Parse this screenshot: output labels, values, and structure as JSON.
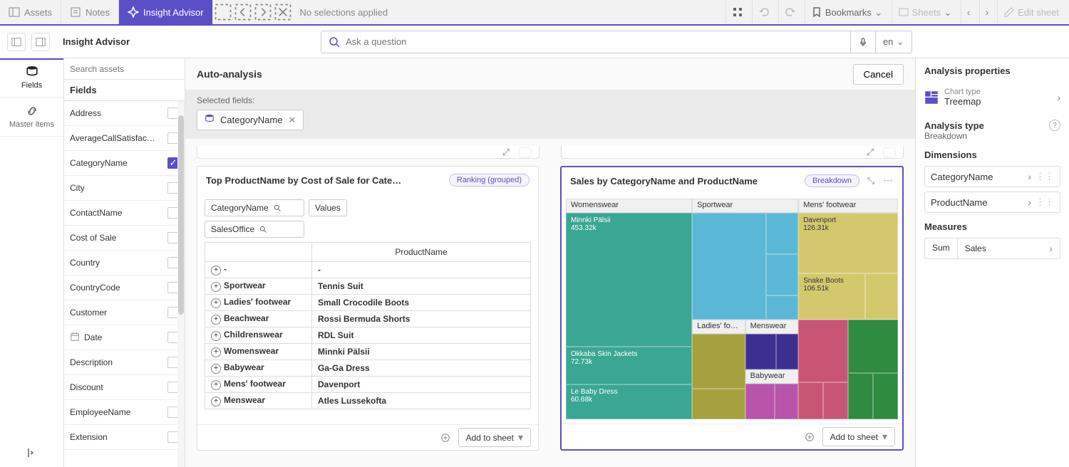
{
  "topbar": {
    "assets": "Assets",
    "notes": "Notes",
    "insight_advisor": "Insight Advisor",
    "no_selections": "No selections applied",
    "bookmarks": "Bookmarks",
    "sheets": "Sheets",
    "edit_sheet": "Edit sheet"
  },
  "row2": {
    "title": "Insight Advisor",
    "placeholder": "Ask a question",
    "lang": "en"
  },
  "rail": {
    "fields": "Fields",
    "master": "Master items"
  },
  "fields": {
    "search_placeholder": "Search assets",
    "header": "Fields",
    "items": [
      {
        "name": "Address",
        "checked": false
      },
      {
        "name": "AverageCallSatisfac…",
        "checked": false
      },
      {
        "name": "CategoryName",
        "checked": true
      },
      {
        "name": "City",
        "checked": false
      },
      {
        "name": "ContactName",
        "checked": false
      },
      {
        "name": "Cost of Sale",
        "checked": false
      },
      {
        "name": "Country",
        "checked": false
      },
      {
        "name": "CountryCode",
        "checked": false
      },
      {
        "name": "Customer",
        "checked": false
      },
      {
        "name": "Date",
        "checked": false,
        "date": true
      },
      {
        "name": "Description",
        "checked": false
      },
      {
        "name": "Discount",
        "checked": false
      },
      {
        "name": "EmployeeName",
        "checked": false
      },
      {
        "name": "Extension",
        "checked": false
      }
    ]
  },
  "center": {
    "title": "Auto-analysis",
    "cancel": "Cancel",
    "selected_label": "Selected fields:",
    "chip": "CategoryName",
    "card1": {
      "title": "Top ProductName by Cost of Sale for Cate…",
      "tag": "Ranking (grouped)",
      "pills": {
        "catname": "CategoryName",
        "salesoffice": "SalesOffice",
        "values": "Values"
      },
      "colhdr": "ProductName",
      "rows": [
        {
          "c": "-",
          "p": "-"
        },
        {
          "c": "Sportwear",
          "p": "Tennis Suit"
        },
        {
          "c": "Ladies' footwear",
          "p": "Small Crocodile Boots"
        },
        {
          "c": "Beachwear",
          "p": "Rossi Bermuda Shorts"
        },
        {
          "c": "Childrenswear",
          "p": "RDL Suit"
        },
        {
          "c": "Womenswear",
          "p": "Minnki Pälsii"
        },
        {
          "c": "Babywear",
          "p": "Ga-Ga Dress"
        },
        {
          "c": "Mens' footwear",
          "p": "Davenport"
        },
        {
          "c": "Menswear",
          "p": "Atles Lussekofta"
        }
      ],
      "addbtn": "Add to sheet"
    },
    "card2": {
      "title": "Sales by CategoryName and ProductName",
      "tag": "Breakdown",
      "addbtn": "Add to sheet",
      "labels": {
        "womenswear": "Womenswear",
        "sportwear": "Sportwear",
        "mensfoot": "Mens' footwear",
        "ladiesfoot": "Ladies' fo…",
        "menswear": "Menswear",
        "babywear": "Babywear",
        "minnki": "Minnki Pälsii",
        "minnki_v": "453.32k",
        "okkaba": "Okkaba Skin Jackets",
        "okkaba_v": "72.73k",
        "lebaby": "Le Baby Dress",
        "lebaby_v": "60.68k",
        "davenport": "Davenport",
        "davenport_v": "126.31k",
        "snake": "Snake Boots",
        "snake_v": "106.51k"
      }
    }
  },
  "props": {
    "title": "Analysis properties",
    "chart_type_label": "Chart type",
    "chart_type": "Treemap",
    "analysis_type_label": "Analysis type",
    "analysis_type": "Breakdown",
    "dims_label": "Dimensions",
    "dim1": "CategoryName",
    "dim2": "ProductName",
    "meas_label": "Measures",
    "agg": "Sum",
    "measure": "Sales"
  },
  "chart_data": {
    "type": "treemap",
    "title": "Sales by CategoryName and ProductName",
    "hierarchy": [
      "CategoryName",
      "ProductName"
    ],
    "measure": "Sales",
    "categories": [
      {
        "name": "Womenswear",
        "products": [
          {
            "name": "Minnki Pälsii",
            "value": 453320
          },
          {
            "name": "Okkaba Skin Jackets",
            "value": 72730
          },
          {
            "name": "Le Baby Dress",
            "value": 60680
          }
        ]
      },
      {
        "name": "Sportwear",
        "products": []
      },
      {
        "name": "Mens' footwear",
        "products": [
          {
            "name": "Davenport",
            "value": 126310
          },
          {
            "name": "Snake Boots",
            "value": 106510
          }
        ]
      },
      {
        "name": "Ladies' footwear",
        "products": []
      },
      {
        "name": "Menswear",
        "products": []
      },
      {
        "name": "Babywear",
        "products": []
      }
    ]
  }
}
